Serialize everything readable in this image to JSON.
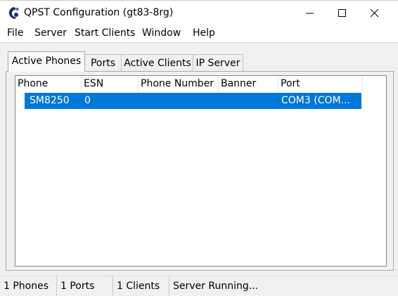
{
  "window": {
    "title": "QPST Configuration (gt83-8rg)",
    "icon": "qpst-app-icon",
    "controls": {
      "minimize_icon": "minimize-icon",
      "maximize_icon": "maximize-icon",
      "close_icon": "close-icon"
    }
  },
  "menu": {
    "items": [
      {
        "label": "File"
      },
      {
        "label": "Server"
      },
      {
        "label": "Start Clients"
      },
      {
        "label": "Window"
      },
      {
        "label": "Help"
      }
    ]
  },
  "tabs": [
    {
      "label": "Active Phones",
      "active": true
    },
    {
      "label": "Ports",
      "active": false
    },
    {
      "label": "Active Clients",
      "active": false
    },
    {
      "label": "IP Server",
      "active": false
    }
  ],
  "table": {
    "columns": [
      "Phone",
      "ESN",
      "Phone Number",
      "Banner",
      "Port"
    ],
    "rows": [
      {
        "phone": "SM8250",
        "esn": "0",
        "phone_number": "",
        "banner": "",
        "port": "COM3 (COM...",
        "selected": true
      }
    ]
  },
  "status": {
    "phones": "1 Phones",
    "ports": "1 Ports",
    "clients": "1 Clients",
    "server": "Server Running..."
  },
  "colors": {
    "selection": "#0078d7",
    "background": "#f0f0f0"
  }
}
